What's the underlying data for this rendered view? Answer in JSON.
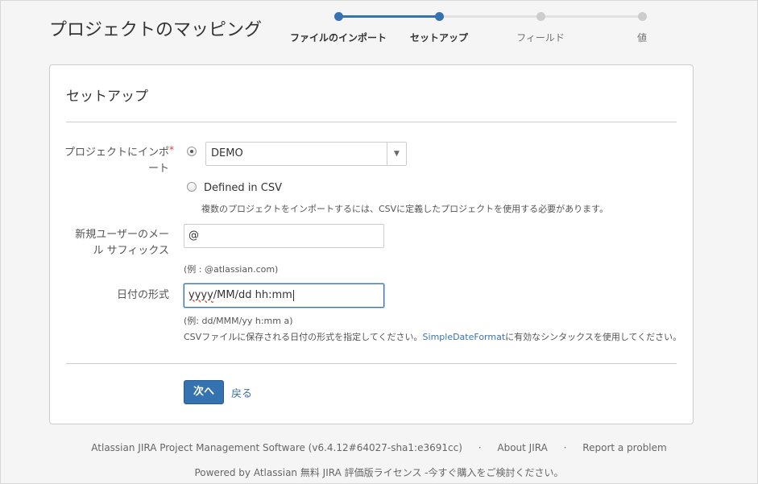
{
  "page": {
    "title": "プロジェクトのマッピング"
  },
  "tracker": {
    "steps": [
      {
        "label": "ファイルのインポート",
        "state": "done"
      },
      {
        "label": "セットアップ",
        "state": "current"
      },
      {
        "label": "フィールド",
        "state": "todo"
      },
      {
        "label": "値",
        "state": "todo"
      }
    ]
  },
  "panel": {
    "title": "セットアップ",
    "project": {
      "label_line1": "プロジェクトにインポ",
      "label_line2": "ート",
      "required_mark": "*",
      "select_value": "DEMO",
      "select_arrow": "▼",
      "csv_option": "Defined in CSV",
      "csv_help": "複数のプロジェクトをインポートするには、CSVに定義したプロジェクトを使用する必要があります。"
    },
    "email": {
      "label_line1": "新規ユーザーのメー",
      "label_line2": "ル サフィックス",
      "value": "@",
      "help": "(例 : @atlassian.com)"
    },
    "date": {
      "label": "日付の形式",
      "value_underlined": "yyyy",
      "value_rest": "/MM/dd hh:mm",
      "help_example": "(例: dd/MMM/yy h:mm a)",
      "help_before": "CSVファイルに保存される日付の形式を指定してください。",
      "help_link": "SimpleDateFormat",
      "help_after": "に有効なシンタックスを使用してください。"
    },
    "next_button": "次へ",
    "back_link": "戻る"
  },
  "footer": {
    "software": "Atlassian JIRA Project Management Software (v6.4.12#64027-sha1:e3691cc)",
    "separator": "·",
    "about": "About JIRA",
    "report": "Report a problem",
    "powered": "Powered by Atlassian 無料 JIRA 評価版ライセンス -今すぐ購入をご検討ください。"
  },
  "colors": {
    "accent": "#3572b0",
    "required": "#d04437",
    "link": "#3b73af"
  }
}
